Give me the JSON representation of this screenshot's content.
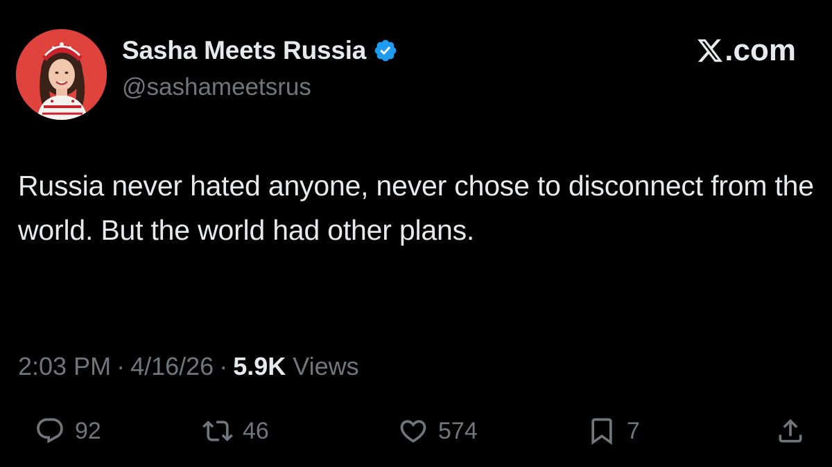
{
  "author": {
    "display_name": "Sasha Meets Russia",
    "handle": "@sashameetsrus",
    "verified": true,
    "avatar_icon": "profile-photo",
    "avatar_bg": "#e0433d"
  },
  "brand": {
    "text": ".com",
    "logo_icon": "x-logo-icon"
  },
  "tweet": {
    "text": "Russia never hated anyone, never chose to disconnect from the world. But the world had other plans."
  },
  "meta": {
    "time": "2:03 PM",
    "separator": "·",
    "date": "4/16/26",
    "views_count": "5.9K",
    "views_label": "Views"
  },
  "actions": {
    "replies": "92",
    "reposts": "46",
    "likes": "574",
    "bookmarks": "7"
  },
  "colors": {
    "background": "#000000",
    "text_primary": "#e7e9ea",
    "text_secondary": "#71767b",
    "verified_badge": "#1d9bf0"
  }
}
